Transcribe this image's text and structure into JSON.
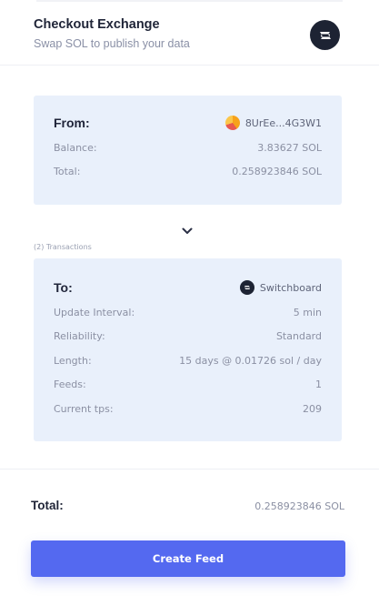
{
  "header": {
    "title": "Checkout Exchange",
    "subtitle": "Swap SOL to publish your data",
    "logo_icon": "switchboard-logo-icon"
  },
  "from_card": {
    "heading": "From:",
    "wallet": "8UrEe...4G3W1",
    "wallet_icon": "wallet-avatar-icon",
    "rows": [
      {
        "label": "Balance:",
        "value": "3.83627 SOL"
      },
      {
        "label": "Total:",
        "value": "0.258923846 SOL"
      }
    ]
  },
  "expand_icon": "chevron-down-icon",
  "transactions_note": "(2) Transactions",
  "to_card": {
    "heading": "To:",
    "recipient": "Switchboard",
    "recipient_icon": "switchboard-logo-icon",
    "rows": [
      {
        "label": "Update Interval:",
        "value": "5 min"
      },
      {
        "label": "Reliability:",
        "value": "Standard"
      },
      {
        "label": "Length:",
        "value": "15 days @ 0.01726 sol / day"
      },
      {
        "label": "Feeds:",
        "value": "1"
      },
      {
        "label": "Current tps:",
        "value": "209"
      }
    ]
  },
  "summary": {
    "total_label": "Total:",
    "total_value": "0.258923846 SOL"
  },
  "actions": {
    "create_label": "Create Feed"
  },
  "colors": {
    "accent": "#5469f0",
    "card_bg": "#e9f0fb",
    "dark": "#1d2333"
  }
}
